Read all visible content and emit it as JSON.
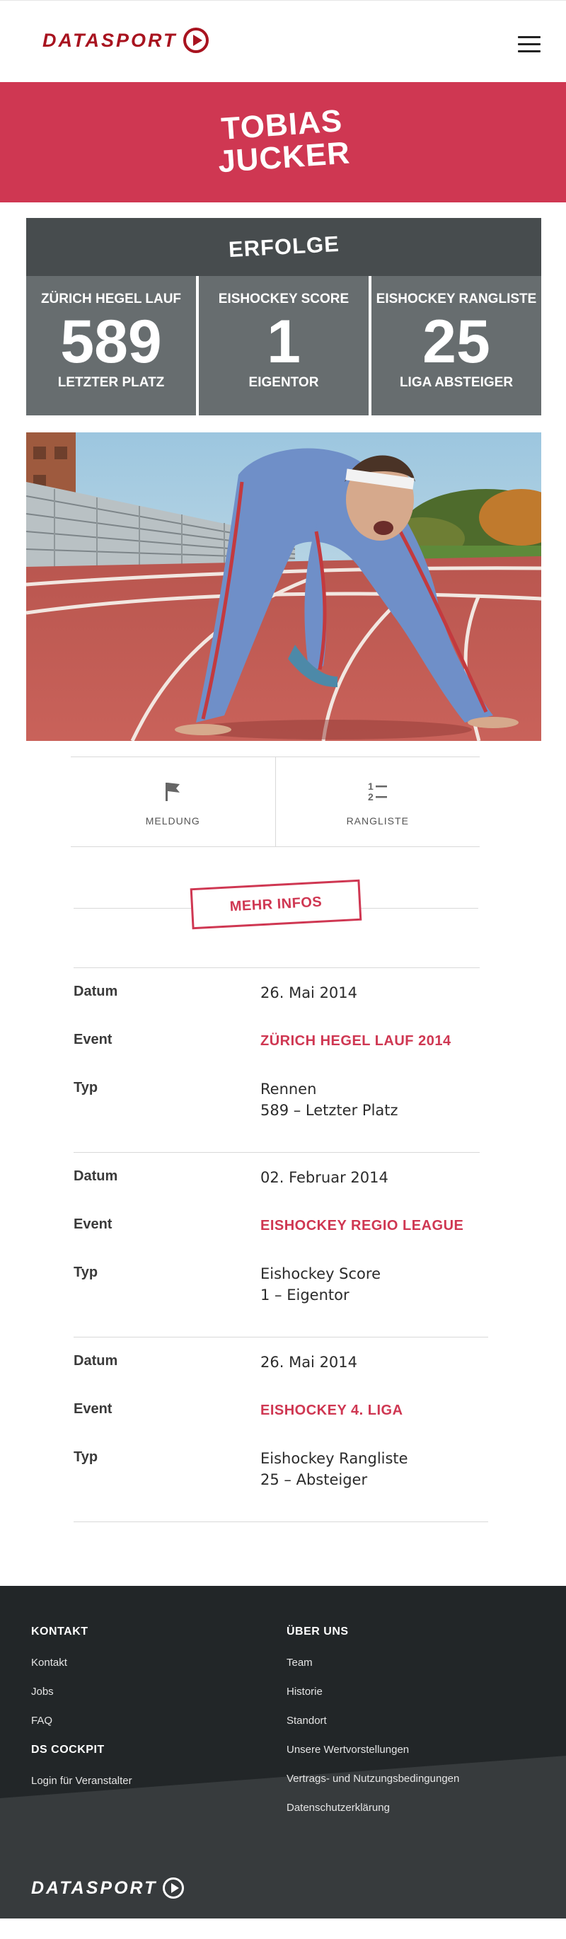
{
  "header": {
    "logo_text": "DATASPORT",
    "menu_icon": "hamburger-menu-icon"
  },
  "hero": {
    "first_name": "TOBIAS",
    "last_name": "JUCKER"
  },
  "erfolge": {
    "title": "ERFOLGE",
    "stats": [
      {
        "label": "ZÜRICH HEGEL LAUF",
        "value": "589",
        "sub": "LETZTER PLATZ"
      },
      {
        "label": "EISHOCKEY SCORE",
        "value": "1",
        "sub": "EIGENTOR"
      },
      {
        "label": "EISHOCKEY RANGLISTE",
        "value": "25",
        "sub": "LIGA ABSTEIGER"
      }
    ]
  },
  "actions": [
    {
      "label": "MELDUNG",
      "icon": "flag-icon"
    },
    {
      "label": "RANGLISTE",
      "icon": "ranking-list-icon"
    }
  ],
  "mehr_infos": {
    "label": "MEHR INFOS"
  },
  "records": [
    {
      "datum_label": "Datum",
      "datum": "26. Mai 2014",
      "event_label": "Event",
      "event": "ZÜRICH HEGEL LAUF 2014",
      "typ_label": "Typ",
      "typ_line1": "Rennen",
      "typ_line2": "589 – Letzter Platz"
    },
    {
      "datum_label": "Datum",
      "datum": "02. Februar 2014",
      "event_label": "Event",
      "event": "EISHOCKEY REGIO LEAGUE",
      "typ_label": "Typ",
      "typ_line1": "Eishockey Score",
      "typ_line2": "1 – Eigentor"
    },
    {
      "datum_label": "Datum",
      "datum": "26. Mai 2014",
      "event_label": "Event",
      "event": "EISHOCKEY 4. LIGA",
      "typ_label": "Typ",
      "typ_line1": "Eishockey Rangliste",
      "typ_line2": "25 – Absteiger"
    }
  ],
  "footer": {
    "kontakt_head": "KONTAKT",
    "kontakt_links": [
      "Kontakt",
      "Jobs",
      "FAQ"
    ],
    "cockpit_head": "DS COCKPIT",
    "cockpit_links": [
      "Login für Veranstalter"
    ],
    "ueber_head": "ÜBER UNS",
    "ueber_links": [
      "Team",
      "Historie",
      "Standort",
      "Unsere Wertvorstellungen",
      "Vertrags- und Nutzungsbedingungen",
      "Datenschutzerklärung"
    ],
    "logo_text": "DATASPORT"
  },
  "colors": {
    "brand_red": "#cf3752",
    "logo_red": "#a8131f",
    "dark_panel": "#474c4e",
    "stat_panel": "#676d6f",
    "footer_bg": "#222628"
  }
}
